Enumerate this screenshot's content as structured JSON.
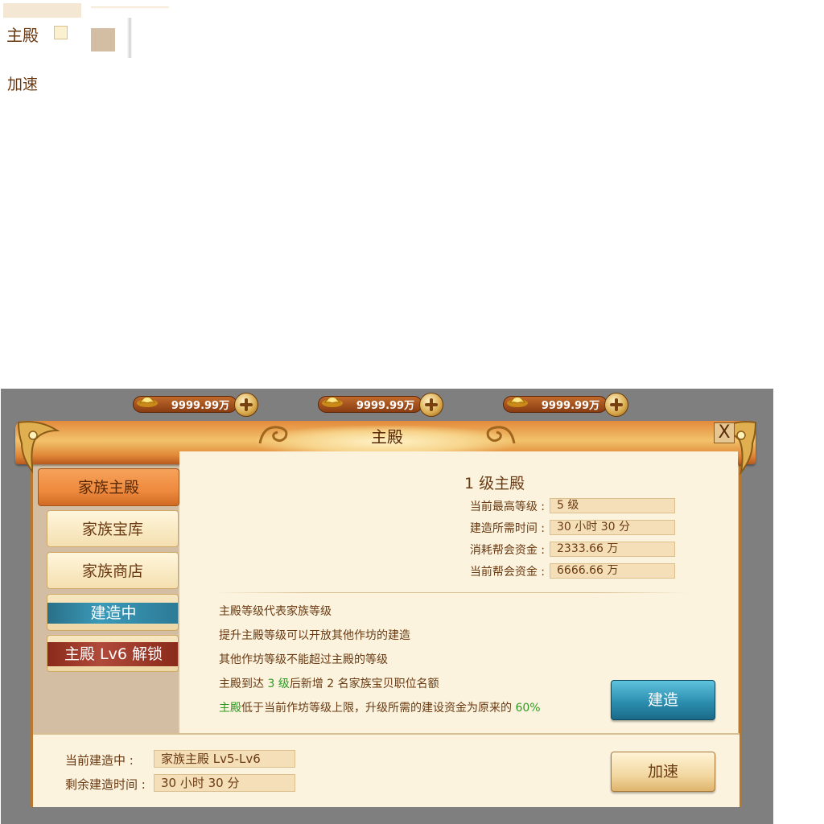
{
  "fragments": {
    "title_label": "主殿",
    "speed_label": "加速"
  },
  "currencies": [
    {
      "value": "9999.99万",
      "icon": "gold-ingot-icon"
    },
    {
      "value": "9999.99万",
      "icon": "gold-ingot-icon"
    },
    {
      "value": "9999.99万",
      "icon": "gold-ingot-icon"
    }
  ],
  "window": {
    "title": "主殿",
    "close_glyph": "X"
  },
  "sidebar": {
    "tabs": [
      {
        "label": "家族主殿"
      },
      {
        "label": "家族宝库"
      },
      {
        "label": "家族商店"
      },
      {
        "label": "建造中"
      },
      {
        "label": "主殿 Lv6 解锁"
      }
    ]
  },
  "building": {
    "title": "1 级主殿",
    "stats": [
      {
        "label": "当前最高等级 :",
        "value": "5 级"
      },
      {
        "label": "建造所需时间 :",
        "value": "30 小时 30 分"
      },
      {
        "label": "消耗帮会资金 :",
        "value": "2333.66 万"
      },
      {
        "label": "当前帮会资金 :",
        "value": "6666.66 万"
      }
    ]
  },
  "description": {
    "line1": "主殿等级代表家族等级",
    "line2": "提升主殿等级可以开放其他作坊的建造",
    "line3": "其他作坊等级不能超过主殿的等级",
    "line4_pre": "主殿到达 ",
    "line4_level": "3 级",
    "line4_post": "后新增 2 名家族宝贝职位名额",
    "line5_pre": "主殿",
    "line5_mid": "低于当前作坊等级上限，升级所需的建设资金为原来的 ",
    "line5_pct": "60%"
  },
  "actions": {
    "build_label": "建造",
    "speed_label": "加速"
  },
  "queue": {
    "current_label": "当前建造中 :",
    "current_value": "家族主殿  Lv5-Lv6",
    "remaining_label": "剩余建造时间 :",
    "remaining_value": "30 小时 30 分"
  },
  "colors": {
    "accent_green": "#2e9a22",
    "panel_cream": "#fbf3de",
    "title_orange": "#e38a3c",
    "build_blue": "#2c8fb0"
  }
}
